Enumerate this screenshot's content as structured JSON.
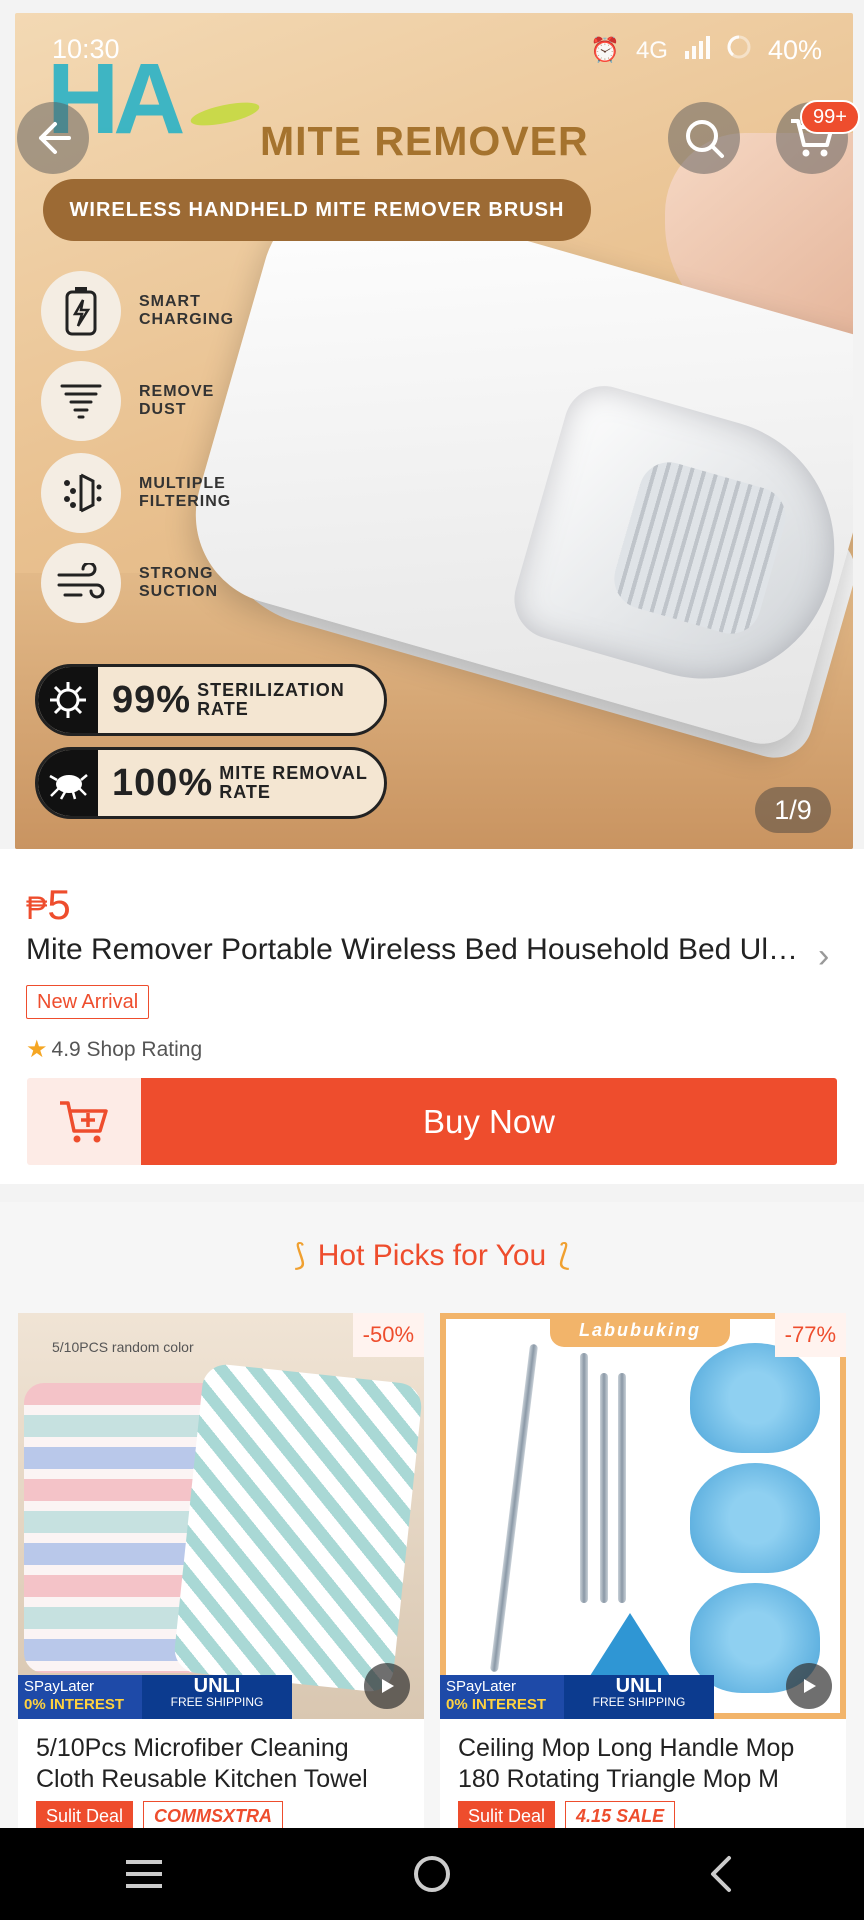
{
  "status_bar": {
    "time": "10:30",
    "battery": "40%",
    "network": "4G"
  },
  "hero": {
    "title": "MITE REMOVER",
    "subtitle": "WIRELESS HANDHELD MITE REMOVER BRUSH",
    "logo_text": "HA",
    "features": [
      {
        "icon": "battery-icon",
        "label": "SMART\nCHARGING"
      },
      {
        "icon": "tornado-icon",
        "label": "REMOVE\nDUST"
      },
      {
        "icon": "filter-icon",
        "label": "MULTIPLE\nFILTERING"
      },
      {
        "icon": "wind-icon",
        "label": "STRONG\nSUCTION"
      }
    ],
    "stats": [
      {
        "icon": "virus-icon",
        "value": "99%",
        "label": "STERILIZATION\nRATE"
      },
      {
        "icon": "mite-icon",
        "value": "100%",
        "label": "MITE REMOVAL\nRATE"
      }
    ],
    "image_counter": "1/9"
  },
  "cart_badge": "99+",
  "product": {
    "currency": "₱",
    "price": "5",
    "name": "Mite Remover Portable Wireless Bed Household Bed Ultraviolet",
    "tag": "New Arrival",
    "rating": "4.9 Shop Rating",
    "buy_label": "Buy Now"
  },
  "hot_picks": {
    "title": "Hot Picks for You",
    "items": [
      {
        "title": "5/10Pcs Microfiber Cleaning Cloth Reusable Kitchen Towel",
        "discount": "-50%",
        "image_note": "5/10PCS random color",
        "promo_top": "SPayLater",
        "promo_bottom": "0% INTEREST",
        "ship_top": "UNLI",
        "ship_bottom": "FREE SHIPPING",
        "tags": [
          "Sulit Deal",
          "COMMSXTRA"
        ]
      },
      {
        "title": "Ceiling Mop Long Handle Mop 180 Rotating Triangle Mop M",
        "discount": "-77%",
        "brand": "Labubuking",
        "promo_top": "SPayLater",
        "promo_bottom": "0% INTEREST",
        "ship_top": "UNLI",
        "ship_bottom": "FREE SHIPPING",
        "tags": [
          "Sulit Deal",
          "4.15 SALE"
        ]
      }
    ]
  },
  "colors": {
    "accent": "#ee4d2d",
    "rating_star": "#f5a623",
    "hot_swirl": "#f0a030"
  }
}
